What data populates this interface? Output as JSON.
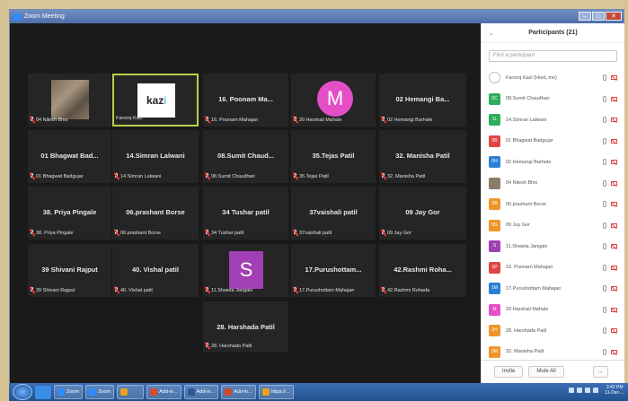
{
  "window": {
    "title": "Zoom Meeting"
  },
  "tiles": [
    {
      "name": "",
      "label": "04 Nilesh Bhoi",
      "kind": "photo"
    },
    {
      "name": "",
      "label": "Farooq Kazi",
      "kind": "logo",
      "logo": "kazi"
    },
    {
      "name": "16. Poonam Ma...",
      "label": "16. Poonam Mahajan",
      "kind": "name"
    },
    {
      "name": "",
      "label": "20 Harshali Mahale",
      "kind": "avatar",
      "letter": "M",
      "color": "#e44fc8"
    },
    {
      "name": "02 Hemangi  Ba...",
      "label": "02 Hemangi  Barhate",
      "kind": "name"
    },
    {
      "name": "01 Bhagwat Bad...",
      "label": "01 Bhagwat Badgujar",
      "kind": "name"
    },
    {
      "name": "14.Simran Lalwani",
      "label": "14.Simran Lalwani",
      "kind": "name"
    },
    {
      "name": "08.Sumit  Chaud...",
      "label": "08.Sumit Chaudhari",
      "kind": "name"
    },
    {
      "name": "35.Tejas Patil",
      "label": "35.Tejas Patil",
      "kind": "name"
    },
    {
      "name": "32. Manisha Patil",
      "label": "32. Manisha Patil",
      "kind": "name"
    },
    {
      "name": "38. Priya Pingale",
      "label": "38. Priya Pingale",
      "kind": "name"
    },
    {
      "name": "06.prashant Borse",
      "label": "06.prashant Borse",
      "kind": "name"
    },
    {
      "name": "34 Tushar patil",
      "label": "34 Tushar patil",
      "kind": "name"
    },
    {
      "name": "37vaishali patil",
      "label": "37vaishali patil",
      "kind": "name"
    },
    {
      "name": "09 Jay Gor",
      "label": "09 Jay Gor",
      "kind": "name"
    },
    {
      "name": "39 Shivani Rajput",
      "label": "39 Shivani Rajput",
      "kind": "name"
    },
    {
      "name": "40. Vishal  patil",
      "label": "40. Vishal  patil",
      "kind": "name"
    },
    {
      "name": "",
      "label": "11.Shweta Jangale",
      "kind": "avatar",
      "letter": "S",
      "color": "#a23fb5"
    },
    {
      "name": "17.Purushottam...",
      "label": "17.Purushottam Mahajan",
      "kind": "name"
    },
    {
      "name": "42.Rashmi Roha...",
      "label": "42.Rashmi Rohada",
      "kind": "name"
    },
    {
      "name": "28. Harshada Patil",
      "label": "28. Harshada Patil",
      "kind": "name"
    }
  ],
  "panel": {
    "title": "Participants (21)",
    "search_placeholder": "Find a participant",
    "participants": [
      {
        "initials": "",
        "name": "Farooq Kazi (Host, me)",
        "color": "#ffffff"
      },
      {
        "initials": "0C",
        "name": "08.Sumit Chaudhari",
        "color": "#2cae5a"
      },
      {
        "initials": "1L",
        "name": "14.Simran Lalwani",
        "color": "#2cae5a"
      },
      {
        "initials": "0B",
        "name": "01 Bhagwat Badgujar",
        "color": "#e04545"
      },
      {
        "initials": "0H",
        "name": "02 Hemangi  Barhate",
        "color": "#2d7fd4"
      },
      {
        "initials": "",
        "name": "04 Nilesh Bhoi",
        "color": "#8b7b68"
      },
      {
        "initials": "0B",
        "name": "06.prashant Borse",
        "color": "#f0952a"
      },
      {
        "initials": "0G",
        "name": "09 Jay Gor",
        "color": "#f0952a"
      },
      {
        "initials": "S",
        "name": "11.Shweta Jangale",
        "color": "#a23fb5"
      },
      {
        "initials": "1P",
        "name": "16. Poonam Mahajan",
        "color": "#e04545"
      },
      {
        "initials": "1M",
        "name": "17.Purushottam Mahajan",
        "color": "#2d7fd4"
      },
      {
        "initials": "M",
        "name": "20 Harshali Mahale",
        "color": "#e44fc8"
      },
      {
        "initials": "2H",
        "name": "28. Harshada Patil",
        "color": "#f0952a"
      },
      {
        "initials": "3M",
        "name": "32. Manisha Patil",
        "color": "#f0952a"
      }
    ],
    "invite_label": "Invite",
    "mute_all_label": "Mute All",
    "more_label": "..."
  },
  "taskbar": {
    "buttons": [
      {
        "label": "Zoom",
        "color": "#2d8cff"
      },
      {
        "label": "Zoom",
        "color": "#2d8cff"
      },
      {
        "label": "",
        "color": "#e8a21b"
      },
      {
        "label": "Add-in...",
        "color": "#d94a2a"
      },
      {
        "label": "Add-in...",
        "color": "#2b579a"
      },
      {
        "label": "Add-in...",
        "color": "#d24726"
      },
      {
        "label": "https://...",
        "color": "#e8a21b"
      }
    ],
    "clock_time": "3:42 PM",
    "clock_date": "11-Dec-..."
  }
}
